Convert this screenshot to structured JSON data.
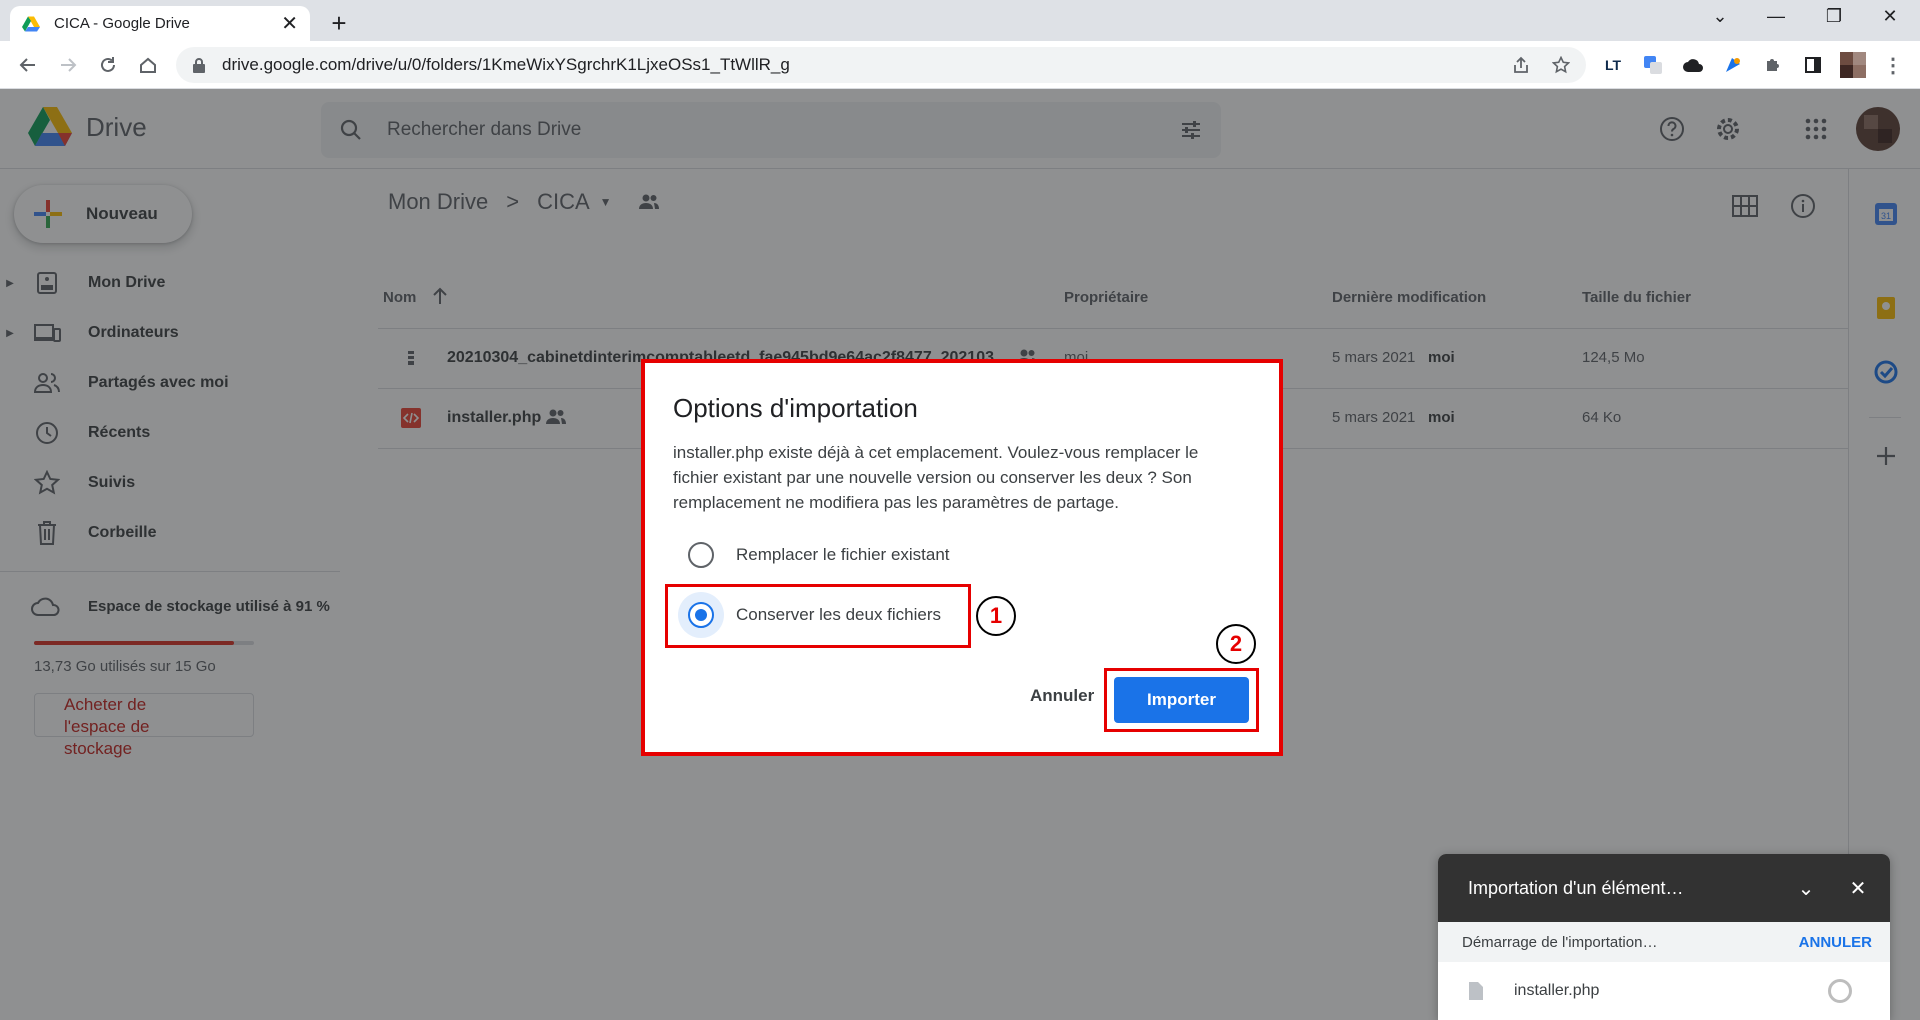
{
  "browser": {
    "tab_title": "CICA - Google Drive",
    "tab_close": "✕",
    "new_tab": "+",
    "url": "drive.google.com/drive/u/0/folders/1KmeWixYSgrchrK1LjxeOSs1_TtWllR_g",
    "extensions": [
      "LT"
    ]
  },
  "drive": {
    "logo_text": "Drive",
    "search_placeholder": "Rechercher dans Drive",
    "new_button": "Nouveau",
    "nav": [
      {
        "label": "Mon Drive"
      },
      {
        "label": "Ordinateurs"
      },
      {
        "label": "Partagés avec moi"
      },
      {
        "label": "Récents"
      },
      {
        "label": "Suivis"
      },
      {
        "label": "Corbeille"
      }
    ],
    "storage": {
      "label": "Espace de stockage utilisé à 91 %",
      "used_fraction": 0.91,
      "text": "13,73 Go utilisés sur 15 Go",
      "buy_button": "Acheter de l'espace de stockage"
    },
    "breadcrumb": {
      "root": "Mon Drive",
      "sep": ">",
      "current": "CICA"
    },
    "table": {
      "headers": {
        "name": "Nom",
        "owner": "Propriétaire",
        "modified": "Dernière modification",
        "size": "Taille du fichier"
      },
      "rows": [
        {
          "name": "20210304_cabinetdinterimcomptableetd_fae945bd9e64ac2f8477_202103…",
          "owner": "moi",
          "modified": "5 mars 2021",
          "modified_by": "moi",
          "size": "124,5 Mo"
        },
        {
          "name": "installer.php",
          "owner": "",
          "modified": "5 mars 2021",
          "modified_by": "moi",
          "size": "64 Ko"
        }
      ]
    }
  },
  "dialog": {
    "title": "Options d'importation",
    "message": "installer.php existe déjà à cet emplacement. Voulez-vous remplacer le fichier existant par une nouvelle version ou conserver les deux ? Son remplacement ne modifiera pas les paramètres de partage.",
    "option_replace": "Remplacer le fichier existant",
    "option_keep": "Conserver les deux fichiers",
    "cancel": "Annuler",
    "import": "Importer",
    "marker_1": "1",
    "marker_2": "2"
  },
  "upload": {
    "title": "Importation d'un élément…",
    "status": "Démarrage de l'importation…",
    "cancel": "ANNULER",
    "file": "installer.php"
  },
  "colors": {
    "accent": "#1a73e8",
    "annotation": "#e60000",
    "storage_bar": "#d93025"
  }
}
